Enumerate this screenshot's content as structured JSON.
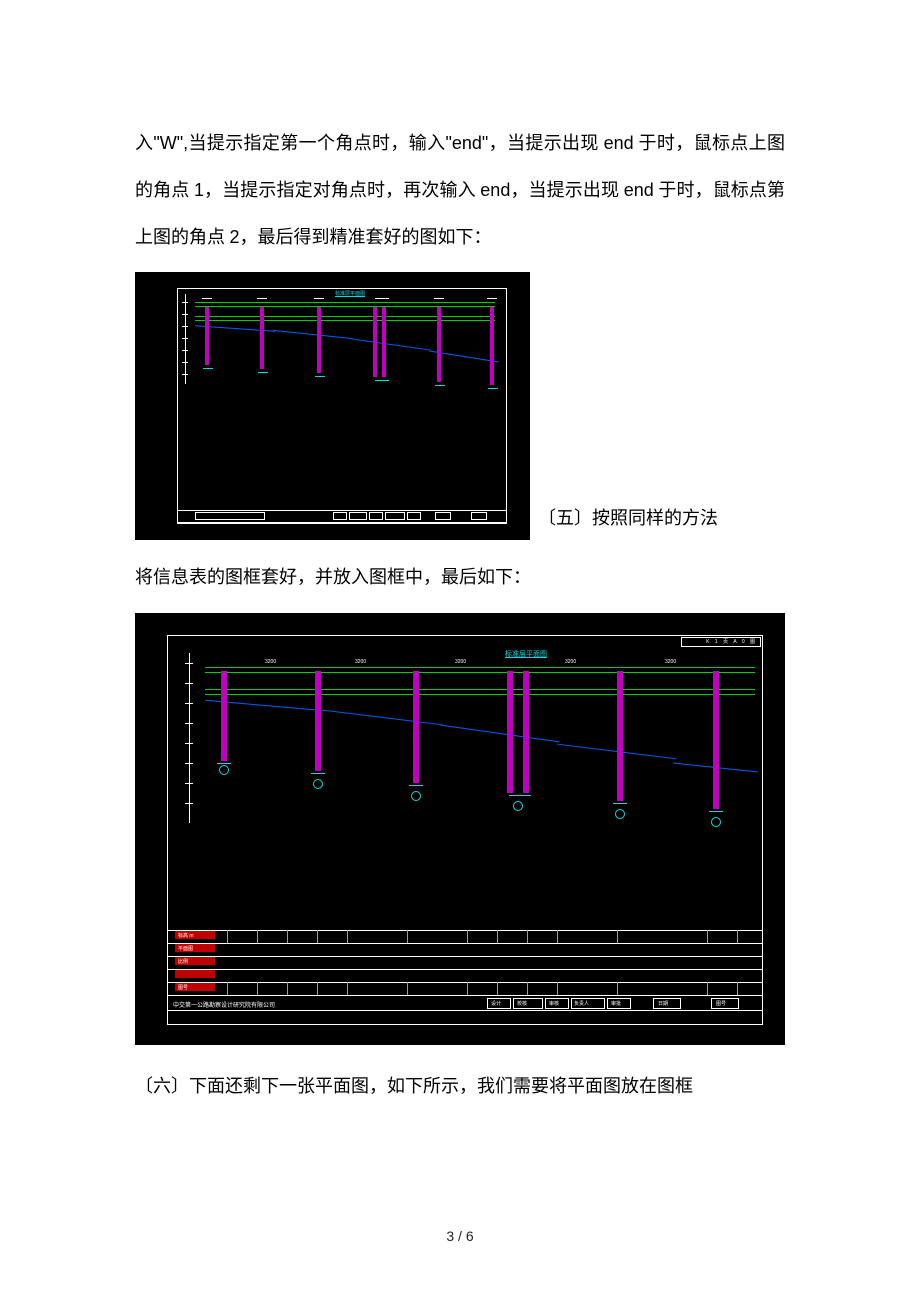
{
  "paragraphs": {
    "p1_a": "入",
    "p1_b": "\"W\",",
    "p1_c": "当提示指定第一个角点时，输入",
    "p1_d": "\"end\"",
    "p1_e": "，当提示出现 ",
    "p1_f": "end",
    "p1_g": " 于时，鼠标点上图的角点 ",
    "p1_h": "1",
    "p1_i": "，当提示指定对角点时，再次输入 ",
    "p1_j": "end",
    "p1_k": "，当提示出现 ",
    "p1_l": "end",
    "p1_m": " 于时，鼠标点第上图的角点 ",
    "p1_n": "2",
    "p1_o": "，最后得到精准套好的图如下：",
    "caption5": "〔五〕按照同样的方法",
    "p2": "将信息表的图框套好，并放入图框中，最后如下：",
    "p3": "〔六〕下面还剩下一张平面图，如下所示，我们需要将平面图放在图框"
  },
  "page_number": "3 / 6",
  "cad1": {
    "title_top": "标准层平面图"
  },
  "cad2": {
    "title_top": "标准层平面图",
    "title_right": "K 1 页 A 0 图",
    "tb_labels": [
      "标高 m",
      "平面图",
      "比例",
      "图号"
    ],
    "bottom_left": "中交第一公路勘察设计研究院有限公司",
    "bottom_cells": [
      "设计",
      "校核",
      "审核",
      "负责人",
      "审批",
      "日期",
      "图号"
    ]
  }
}
